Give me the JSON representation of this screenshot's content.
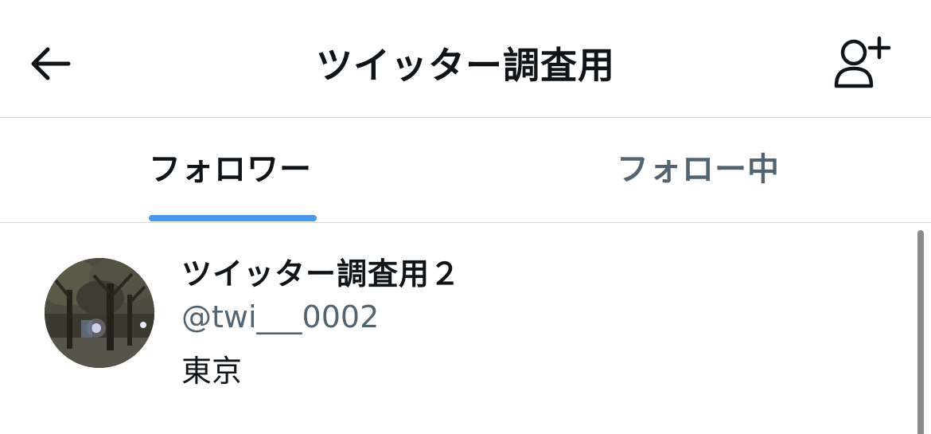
{
  "header": {
    "title": "ツイッター調査用",
    "back_icon": "back-arrow-icon",
    "add_user_icon": "add-user-icon"
  },
  "tabs": [
    {
      "label": "フォロワー",
      "active": true
    },
    {
      "label": "フォロー中",
      "active": false
    }
  ],
  "users": [
    {
      "name": "ツイッター調査用２",
      "handle": "@twi___0002",
      "bio": "東京",
      "avatar": "park-at-night-photo"
    }
  ],
  "colors": {
    "accent": "#4a99e9",
    "text_primary": "#0f1419",
    "text_secondary": "#536471",
    "divider": "#d6d9db"
  }
}
